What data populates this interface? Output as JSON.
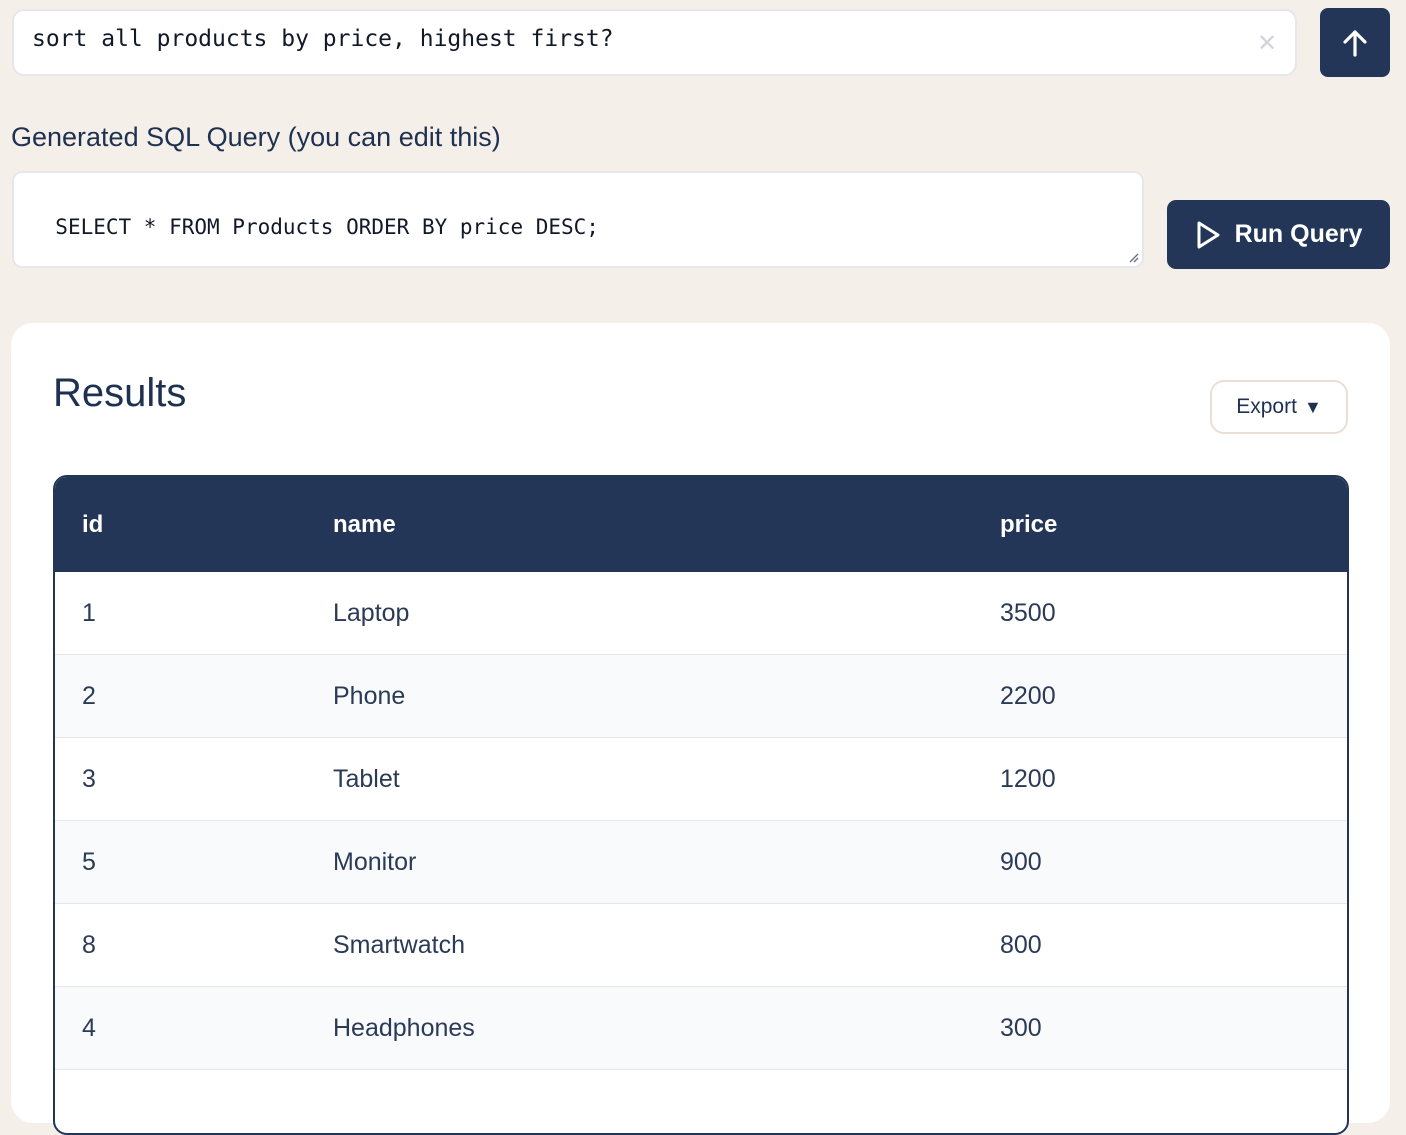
{
  "prompt": {
    "value": "sort all products by price, highest first?",
    "clear_icon": "close-icon",
    "send_icon": "arrow-up-icon"
  },
  "sql": {
    "label": "Generated SQL Query (you can edit this)",
    "query": "SELECT * FROM Products ORDER BY price DESC;",
    "run_label": "Run Query",
    "run_icon": "play-icon"
  },
  "results": {
    "title": "Results",
    "export_label": "Export",
    "export_caret": "▼",
    "columns": [
      "id",
      "name",
      "price"
    ],
    "rows": [
      [
        "1",
        "Laptop",
        "3500"
      ],
      [
        "2",
        "Phone",
        "2200"
      ],
      [
        "3",
        "Tablet",
        "1200"
      ],
      [
        "5",
        "Monitor",
        "900"
      ],
      [
        "8",
        "Smartwatch",
        "800"
      ],
      [
        "4",
        "Headphones",
        "300"
      ]
    ]
  },
  "colors": {
    "accent": "#233657",
    "background": "#f5efe9"
  }
}
